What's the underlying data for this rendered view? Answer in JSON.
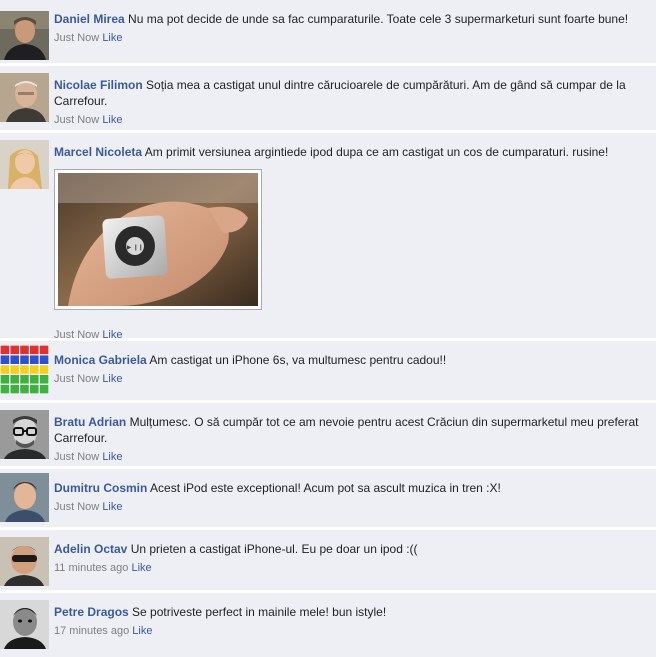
{
  "comments": [
    {
      "author": "Daniel Mirea",
      "text": "Nu ma pot decide de unde sa fac cumparaturile. Toate cele 3 supermarketuri sunt foarte bune!",
      "time": "Just Now",
      "like": "Like",
      "avatar": "man-avatar-dark-jacket"
    },
    {
      "author": "Nicolae Filimon",
      "text": "Soția mea a castigat unul dintre cărucioarele de cumpărături. Am de gând să cumpar de la Carrefour.",
      "time": "Just Now",
      "like": "Like",
      "avatar": "older-man-avatar"
    },
    {
      "author": "Marcel Nicoleta",
      "text": "Am primit versiunea argintiede ipod dupa ce am castigat un cos de cumparaturi. rusine!",
      "time": "Just Now",
      "like": "Like",
      "avatar": "blonde-woman-avatar",
      "attachment": "silver-ipod-shuffle-in-hand-photo"
    },
    {
      "author": "Monica Gabriela",
      "text": "Am castigat un iPhone 6s, va multumesc pentru cadou!!",
      "time": "Just Now",
      "like": "Like",
      "avatar": "colorful-pixel-grid-avatar"
    },
    {
      "author": "Bratu Adrian",
      "text": "Mulțumesc. O să cumpăr tot ce am nevoie pentru acest Crăciun din supermarketul meu preferat Carrefour.",
      "time": "Just Now",
      "like": "Like",
      "avatar": "man-with-glasses-bw-avatar"
    },
    {
      "author": "Dumitru Cosmin",
      "text": "Acest iPod este exceptional! Acum pot sa ascult muzica in tren :X!",
      "time": "Just Now",
      "like": "Like",
      "avatar": "young-man-avatar"
    },
    {
      "author": "Adelin Octav",
      "text": "Un prieten a castigat iPhone-ul. Eu pe doar un ipod :((",
      "time": "11 minutes ago",
      "like": "Like",
      "avatar": "man-sunglasses-avatar"
    },
    {
      "author": "Petre Dragos",
      "text": "Se potriveste perfect in mainile mele! bun istyle!",
      "time": "17 minutes ago",
      "like": "Like",
      "avatar": "man-bw-portrait-avatar"
    }
  ],
  "colors": {
    "background": "#edeff4",
    "link": "#3b5998",
    "meta": "#7f7f7f"
  }
}
